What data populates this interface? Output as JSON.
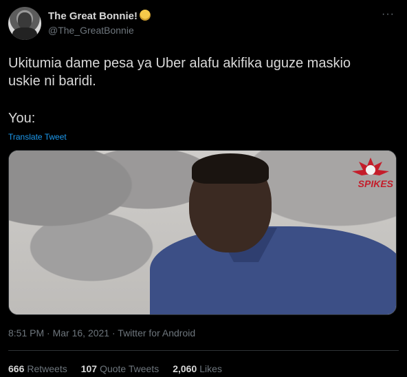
{
  "author": {
    "display_name": "The Great Bonnie!",
    "handle": "@The_GreatBonnie"
  },
  "tweet": {
    "text_line1": "Ukitumia dame pesa ya Uber alafu akifika uguze maskio",
    "text_line2": "uskie ni baridi.",
    "text_you": "You:",
    "translate_label": "Translate Tweet",
    "media_logo_text": "SPIKES"
  },
  "meta": {
    "time": "8:51 PM",
    "separator1": "·",
    "date": "Mar 16, 2021",
    "separator2": "·",
    "source": "Twitter for Android"
  },
  "stats": [
    {
      "count": "666",
      "label": "Retweets"
    },
    {
      "count": "107",
      "label": "Quote Tweets"
    },
    {
      "count": "2,060",
      "label": "Likes"
    }
  ],
  "icons": {
    "more": "more-horizontal-icon",
    "verified_emoji": "emoji-icon"
  }
}
